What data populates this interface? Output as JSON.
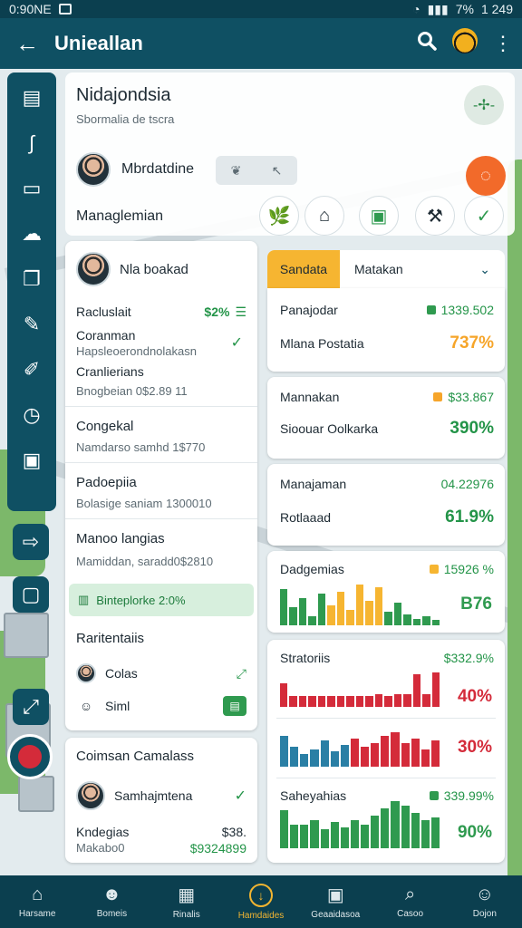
{
  "status_bar": {
    "time_left": "0:90NE",
    "time_right": "1 249",
    "battery": "7%"
  },
  "app_bar": {
    "title": "Unieallan"
  },
  "header": {
    "title": "Nidajondsia",
    "subtitle": "Sbormalia de tscra",
    "user_name": "Mbrdatdine",
    "section_label": "Managlemian"
  },
  "summary_card": {
    "user_name": "Nla boakad",
    "row1_label": "Racluslait",
    "row1_value": "$2%",
    "row2_label": "Coranman",
    "row2_sub": "Hapsleoerondnolakasn",
    "row3_label": "Cranlierians",
    "row3_sub": "Bnogbeian 0$2.89 11"
  },
  "list_rows": [
    {
      "title": "Congekal",
      "sub": "Namdarso samhd 1$770"
    },
    {
      "title": "Padoepiia",
      "sub": "Bolasige saniam 1300010"
    },
    {
      "title": "Manoo langias",
      "sub": "Mamiddan, saradd0$2810"
    }
  ],
  "green_pill": "Binteplorke 2:0%",
  "raid_card": {
    "title": "Raritentaiis",
    "items": [
      {
        "label": "Colas"
      },
      {
        "label": "Siml"
      }
    ]
  },
  "coinsan_card": {
    "title": "Coimsan Camalass",
    "user_name": "Samhajmtena",
    "row_label": "Kndegias",
    "row_value": "$38.",
    "row_sub": "Makabo0",
    "row_sub_value": "$9324899"
  },
  "tabs": {
    "active": "Sandata",
    "other": "Matakan"
  },
  "metric_cards": [
    {
      "r1_label": "Panajodar",
      "r1_value": "1339.502",
      "r2_label": "Mlana Postatia",
      "r2_value": "737%",
      "accent": "#2f9a4f",
      "big_color": "#f6a52a"
    },
    {
      "r1_label": "Mannakan",
      "r1_value": "$33.867",
      "r2_label": "Sioouar Oolkarka",
      "r2_value": "390%",
      "accent": "#f6a52a",
      "big_color": "#2f9a4f"
    },
    {
      "r1_label": "Manajaman",
      "r1_value": "04.22976",
      "r2_label": "Rotlaaad",
      "r2_value": "61.9%",
      "accent": "#2f9a4f",
      "big_color": "#2f9a4f"
    }
  ],
  "chart_cards": [
    {
      "label": "Dadgemias",
      "value": "15926 %",
      "big": "B76",
      "big_color": "#2f9a4f",
      "accent": "#f6a52a"
    },
    {
      "label": "Stratoriis",
      "value": "$332.9%",
      "big": "40%",
      "big_color": "#d42b3a",
      "accent": "#d42b3a"
    },
    {
      "label": "",
      "value": "",
      "big": "30%",
      "big_color": "#d42b3a",
      "accent": "#d42b3a"
    },
    {
      "label": "Saheyahias",
      "value": "339.99%",
      "big": "90%",
      "big_color": "#2f9a4f",
      "accent": "#2f9a4f"
    }
  ],
  "bottom_nav": [
    {
      "label": "Harsame",
      "icon": "home-icon"
    },
    {
      "label": "Bomeis",
      "icon": "person-icon"
    },
    {
      "label": "Rinalis",
      "icon": "briefcase-icon"
    },
    {
      "label": "Hamdaides",
      "icon": "download-icon"
    },
    {
      "label": "Geaaidasoa",
      "icon": "clipboard-icon"
    },
    {
      "label": "Casoo",
      "icon": "search-icon"
    },
    {
      "label": "Dojon",
      "icon": "user-icon"
    }
  ],
  "colors": {
    "primary": "#0f5063",
    "accent_orange": "#f6b531",
    "green": "#2f9a4f",
    "red": "#d42b3a",
    "fab_orange": "#f26a2a"
  }
}
